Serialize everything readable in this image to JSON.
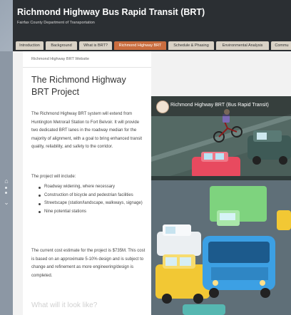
{
  "header": {
    "title": "Richmond Highway Bus Rapid Transit (BRT)",
    "subtitle": "Fairfax County Department of Transportation"
  },
  "tabs": [
    {
      "label": "Introduction",
      "active": false
    },
    {
      "label": "Background",
      "active": false
    },
    {
      "label": "What is BRT?",
      "active": false
    },
    {
      "label": "Richmond Highway BRT",
      "active": true
    },
    {
      "label": "Schedule & Phasing",
      "active": false
    },
    {
      "label": "Environmental Analysis",
      "active": false
    },
    {
      "label": "Commu",
      "active": false
    }
  ],
  "sidebar": {
    "home_icon": "home-icon",
    "expand_icon": "chevron-down-icon"
  },
  "content": {
    "breadcrumb": "Richmond Highway BRT Website",
    "heading": "The Richmond Highway BRT Project",
    "para1": "The Richmond Highway BRT system will extend from Huntington Metrorail Station to Fort Belvoir. It will provide two dedicated BRT lanes in the roadway median for the majority of alignment, with a goal to bring enhanced transit quality, reliability, and safety to the corridor.",
    "list_intro": "The project will include:",
    "items": [
      "Roadway widening, where necessary",
      "Construction of bicycle and pedestrian facilities",
      "Streetscape (station/landscape, walkways, signage)",
      "Nine potential stations"
    ],
    "para2": "The current cost estimate for the project is $735M. This cost is based on an approximate 5-10% design and is subject to change and refinement as more engineering/design is completed.",
    "subheading": "What will it look like?"
  },
  "video": {
    "title": "Richmond Highway BRT (Bus Rapid Transit)",
    "logo_icon": "county-seal-icon"
  },
  "colors": {
    "header_bg": "#2b2f33",
    "tab_bg": "#d9d2c6",
    "tab_active": "#c96d3f"
  }
}
